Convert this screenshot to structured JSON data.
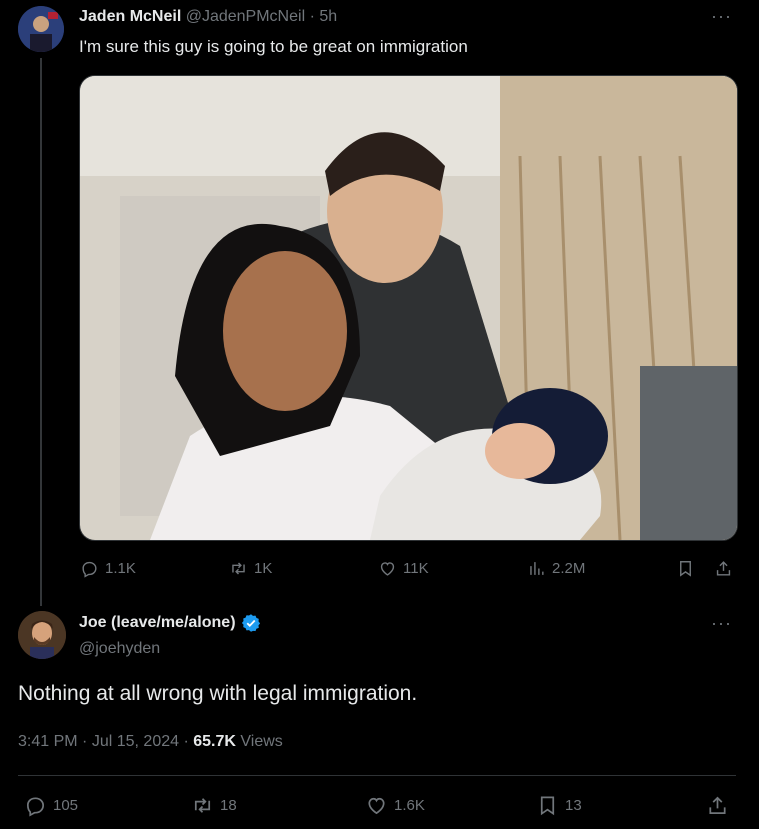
{
  "tweet1": {
    "author_name": "Jaden McNeil",
    "handle": "@JadenPMcNeil",
    "separator": "·",
    "time": "5h",
    "text": "I'm sure this guy is going to be great on immigration",
    "more": "···",
    "actions": {
      "replies": "1.1K",
      "retweets": "1K",
      "likes": "11K",
      "views": "2.2M"
    }
  },
  "tweet2": {
    "author_name": "Joe (leave/me/alone)",
    "handle": "@joehyden",
    "more": "···",
    "text": "Nothing at all wrong with legal immigration.",
    "meta": {
      "time": "3:41 PM",
      "dot1": "·",
      "date": "Jul 15, 2024",
      "dot2": "·",
      "views_count": "65.7K",
      "views_label": "Views"
    },
    "actions": {
      "replies": "105",
      "retweets": "18",
      "likes": "1.6K",
      "bookmarks": "13"
    }
  },
  "colors": {
    "background": "#000000",
    "text": "#e7e9ea",
    "muted": "#71767b",
    "verified": "#1d9bf0",
    "divider": "#2f3336"
  }
}
